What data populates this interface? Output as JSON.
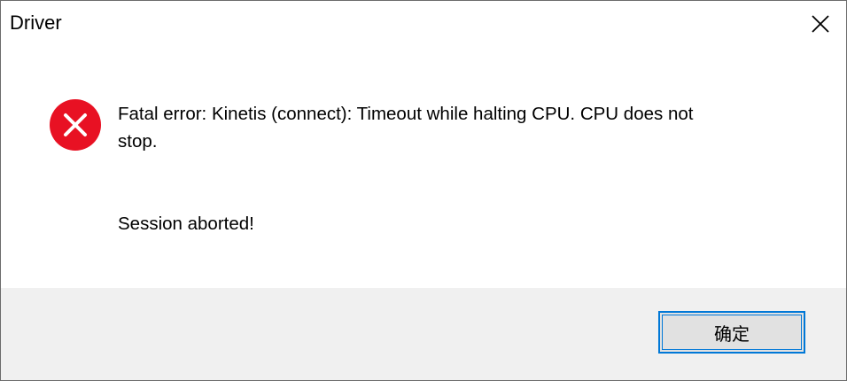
{
  "window": {
    "title": "Driver"
  },
  "dialog": {
    "icon": "error-icon",
    "message_line1": "Fatal error: Kinetis (connect): Timeout while halting CPU. CPU does not",
    "message_line2": "stop.",
    "session_text": "Session aborted!"
  },
  "footer": {
    "ok_label": "确定"
  },
  "colors": {
    "error_red": "#e81123",
    "button_border": "#0078d7",
    "footer_bg": "#f0f0f0",
    "button_bg": "#e1e1e1"
  }
}
